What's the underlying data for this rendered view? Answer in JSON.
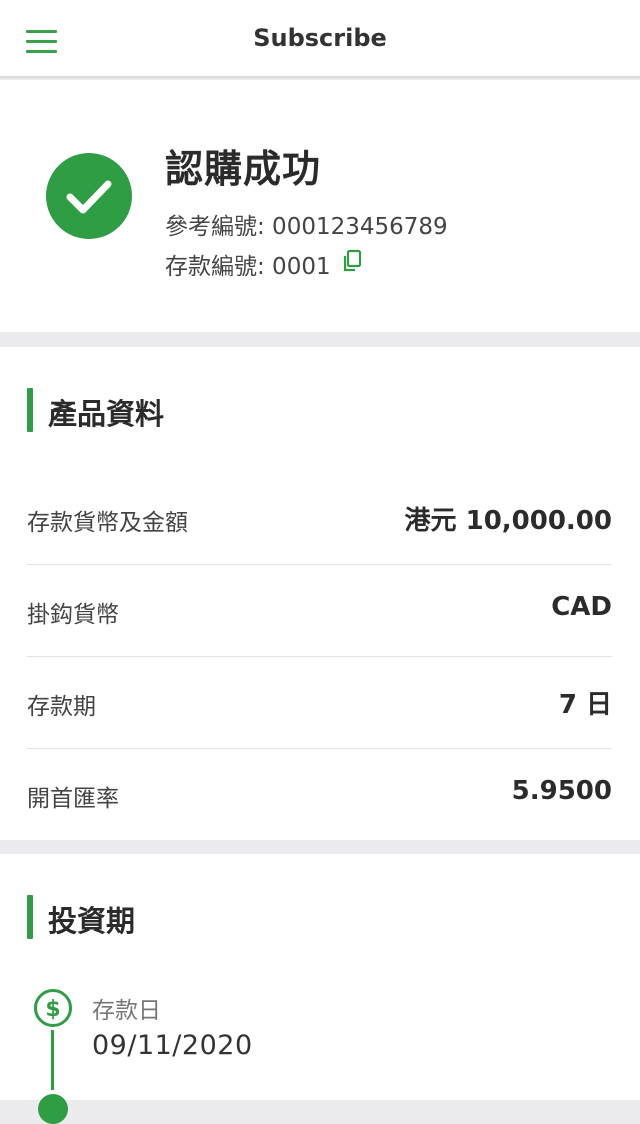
{
  "header": {
    "title": "Subscribe",
    "menu_icon": "hamburger-menu-icon"
  },
  "success": {
    "icon": "check-circle-icon",
    "title": "認購成功",
    "reference_line": "參考編號: 000123456789",
    "deposit_line": "存款編號: 0001",
    "copy_icon": "copy-icon"
  },
  "product": {
    "section_title": "產品資料",
    "rows": [
      {
        "label": "存款貨幣及金額",
        "value": "港元 10,000.00"
      },
      {
        "label": "掛鈎貨幣",
        "value": "CAD"
      },
      {
        "label": "存款期",
        "value": "7 日"
      },
      {
        "label": "開首匯率",
        "value": "5.9500"
      }
    ]
  },
  "investment": {
    "section_title": "投資期",
    "timeline": [
      {
        "icon": "dollar-circle-icon",
        "label": "存款日",
        "date": "09/11/2020"
      }
    ]
  },
  "colors": {
    "accent": "#2e9d43",
    "background": "#ececef",
    "card": "#ffffff",
    "text": "#2b2b2b"
  }
}
